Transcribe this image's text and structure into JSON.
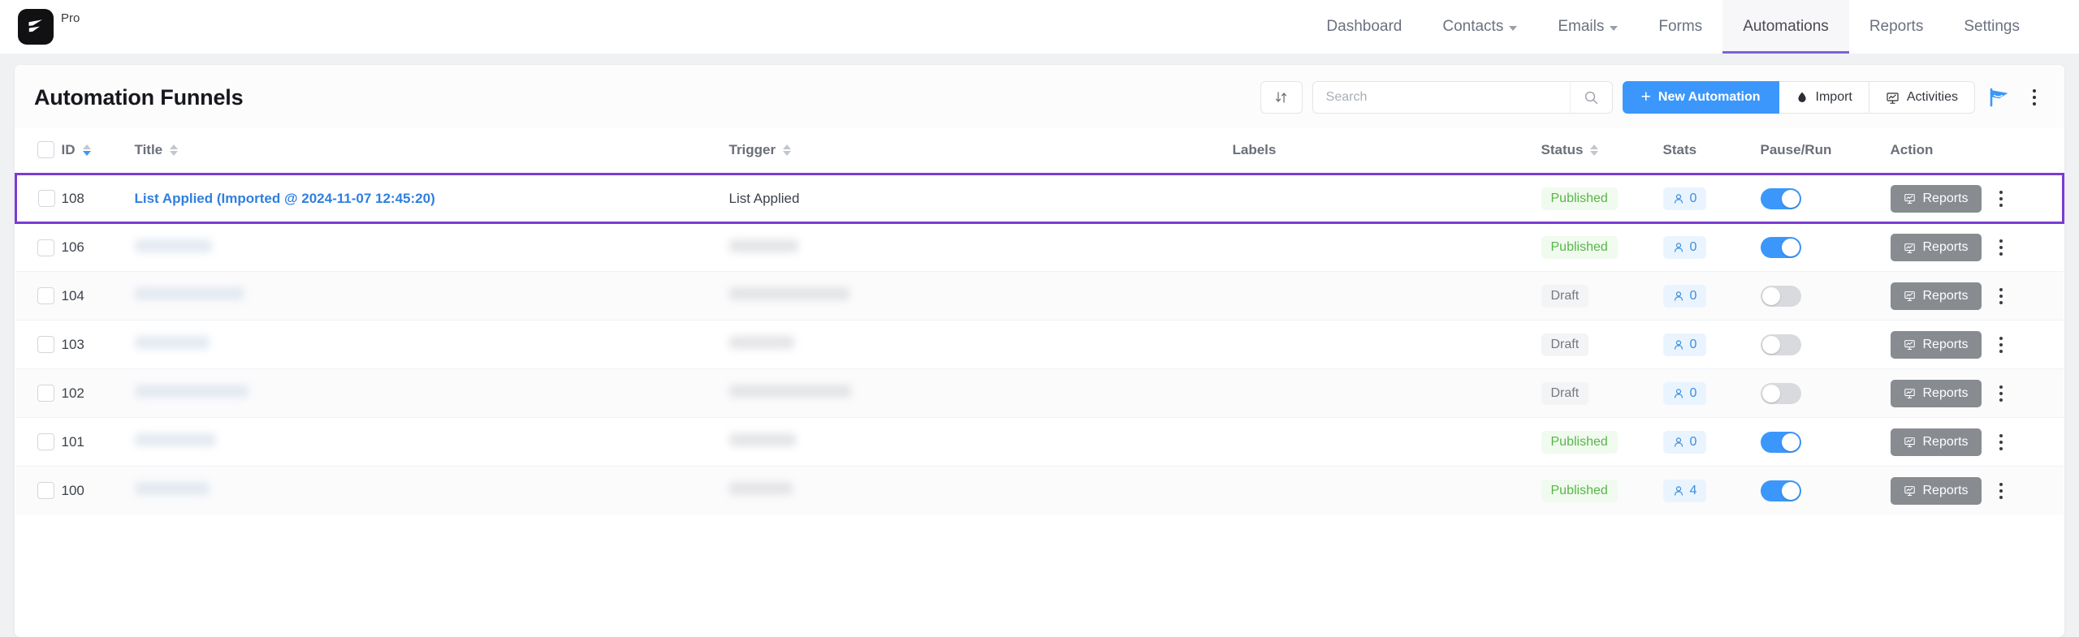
{
  "brand": {
    "badge": "Pro",
    "logo_icon": "fluent-crm-logo-icon"
  },
  "nav": {
    "items": [
      {
        "label": "Dashboard",
        "has_caret": false,
        "active": false
      },
      {
        "label": "Contacts",
        "has_caret": true,
        "active": false
      },
      {
        "label": "Emails",
        "has_caret": true,
        "active": false
      },
      {
        "label": "Forms",
        "has_caret": false,
        "active": false
      },
      {
        "label": "Automations",
        "has_caret": false,
        "active": true
      },
      {
        "label": "Reports",
        "has_caret": false,
        "active": false
      },
      {
        "label": "Settings",
        "has_caret": false,
        "active": false
      }
    ]
  },
  "header": {
    "title": "Automation Funnels",
    "sort_icon": "sort-arrows-icon",
    "search": {
      "placeholder": "Search",
      "value": "",
      "icon": "search-icon"
    },
    "new_automation": {
      "label": "New Automation",
      "icon": "plus-icon"
    },
    "import": {
      "label": "Import",
      "icon": "import-icon"
    },
    "activities": {
      "label": "Activities",
      "icon": "activities-board-icon"
    },
    "academy_icon": "graduation-flag-icon",
    "more_icon": "kebab-menu-icon",
    "accent_blue": "#3b97fb"
  },
  "table": {
    "columns": [
      {
        "label": "",
        "sortable": false,
        "key": "check"
      },
      {
        "label": "ID",
        "sortable": true,
        "sort_active": true,
        "sort_dir": "desc"
      },
      {
        "label": "Title",
        "sortable": true,
        "sort_active": false
      },
      {
        "label": "Trigger",
        "sortable": true,
        "sort_active": false
      },
      {
        "label": "Labels",
        "sortable": false
      },
      {
        "label": "Status",
        "sortable": true,
        "sort_active": false
      },
      {
        "label": "Stats",
        "sortable": false
      },
      {
        "label": "Pause/Run",
        "sortable": false
      },
      {
        "label": "Action",
        "sortable": false
      }
    ],
    "reports_label": "Reports",
    "rows": [
      {
        "id": "108",
        "title": "List Applied (Imported @ 2024-11-07 12:45:20)",
        "title_redacted": false,
        "trigger": "List Applied",
        "trigger_redacted": false,
        "labels": "",
        "status": "Published",
        "stats": "0",
        "toggle_on": true,
        "highlighted": true
      },
      {
        "id": "106",
        "title": "",
        "title_redacted": true,
        "title_redact_w": 95,
        "trigger": "",
        "trigger_redacted": true,
        "trigger_redact_w": 85,
        "labels": "",
        "status": "Published",
        "stats": "0",
        "toggle_on": true,
        "highlighted": false
      },
      {
        "id": "104",
        "title": "",
        "title_redacted": true,
        "title_redact_w": 135,
        "trigger": "",
        "trigger_redacted": true,
        "trigger_redact_w": 148,
        "labels": "",
        "status": "Draft",
        "stats": "0",
        "toggle_on": false,
        "highlighted": false
      },
      {
        "id": "103",
        "title": "",
        "title_redacted": true,
        "title_redact_w": 92,
        "trigger": "",
        "trigger_redacted": true,
        "trigger_redact_w": 80,
        "labels": "",
        "status": "Draft",
        "stats": "0",
        "toggle_on": false,
        "highlighted": false
      },
      {
        "id": "102",
        "title": "",
        "title_redacted": true,
        "title_redact_w": 140,
        "trigger": "",
        "trigger_redacted": true,
        "trigger_redact_w": 150,
        "labels": "",
        "status": "Draft",
        "stats": "0",
        "toggle_on": false,
        "highlighted": false
      },
      {
        "id": "101",
        "title": "",
        "title_redacted": true,
        "title_redact_w": 100,
        "trigger": "",
        "trigger_redacted": true,
        "trigger_redact_w": 82,
        "labels": "",
        "status": "Published",
        "stats": "0",
        "toggle_on": true,
        "highlighted": false
      },
      {
        "id": "100",
        "title": "",
        "title_redacted": true,
        "title_redact_w": 92,
        "trigger": "",
        "trigger_redacted": true,
        "trigger_redact_w": 78,
        "labels": "",
        "status": "Published",
        "stats": "4",
        "toggle_on": true,
        "highlighted": false
      }
    ]
  }
}
